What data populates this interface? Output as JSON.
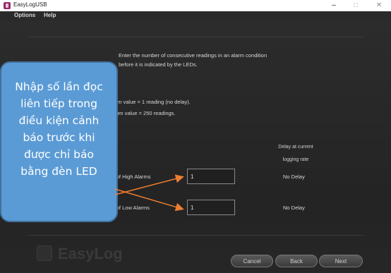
{
  "window": {
    "title": "EasyLogUSB",
    "controls": [
      "–",
      "□",
      "✕"
    ]
  },
  "menu": {
    "items": [
      "Options",
      "Help"
    ]
  },
  "main": {
    "instruction_line1": "Enter the number of consecutive readings in an alarm condition",
    "instruction_line2": "before it is indicated by the LEDs.",
    "min_text": "Minimum value = 1 reading (no delay).",
    "max_text": "Maximum value = 250 readings.",
    "column_header_line1": "Delay at current",
    "column_header_line2": "logging rate",
    "high_alarm": {
      "label": "Number of High Alarms",
      "value": "1",
      "delay": "No Delay"
    },
    "low_alarm": {
      "label": "Number of Low Alarms",
      "value": "1",
      "delay": "No Delay"
    }
  },
  "buttons": {
    "cancel": "Cancel",
    "back": "Back",
    "next": "Next"
  },
  "logo": {
    "text": "EasyLog"
  },
  "callout": {
    "lines": [
      "Nhập số lần đọc",
      "liên tiếp trong",
      "điều kiện cảnh",
      "báo trước khi",
      "được chỉ báo",
      "bằng đèn LED"
    ],
    "color": "#5b9bd5"
  },
  "arrow_color": "#ed7d31"
}
